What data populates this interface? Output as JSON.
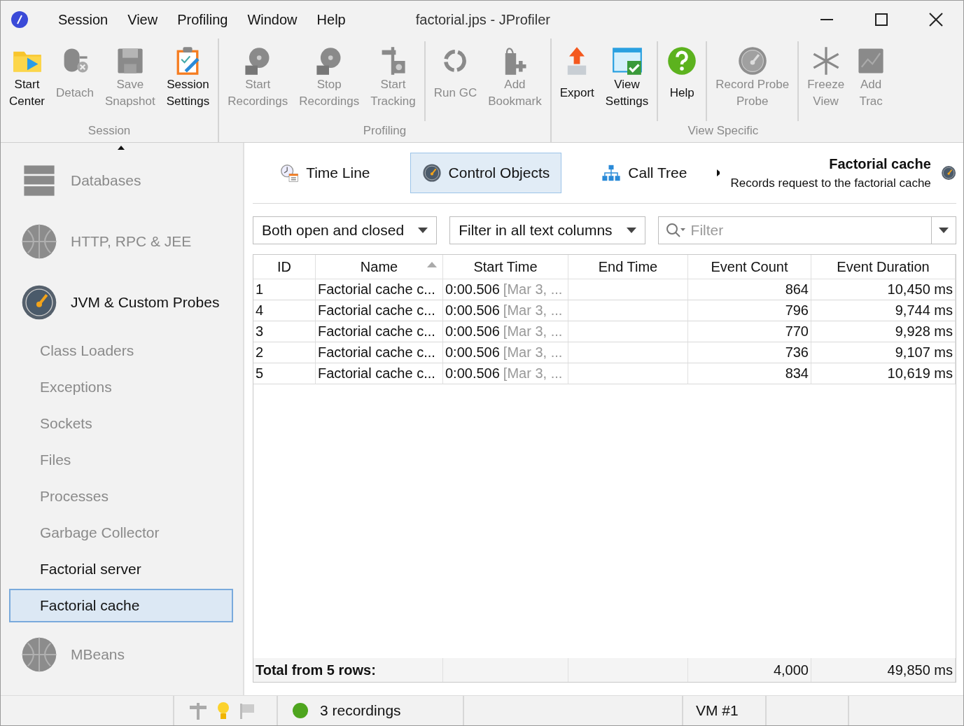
{
  "window": {
    "title": "factorial.jps - JProfiler",
    "menu": [
      "Session",
      "View",
      "Profiling",
      "Window",
      "Help"
    ]
  },
  "toolbar": [
    {
      "label": "Session",
      "sections": [
        [
          {
            "lines": [
              "Start",
              "Center"
            ],
            "disabled": false
          },
          {
            "lines": [
              "Detach"
            ],
            "disabled": true
          },
          {
            "lines": [
              "Save",
              "Snapshot"
            ],
            "disabled": true
          },
          {
            "lines": [
              "Session",
              "Settings"
            ],
            "disabled": false
          }
        ]
      ]
    },
    {
      "label": "Profiling",
      "sections": [
        [
          {
            "lines": [
              "Start",
              "Recordings"
            ],
            "disabled": true
          },
          {
            "lines": [
              "Stop",
              "Recordings"
            ],
            "disabled": true
          },
          {
            "lines": [
              "Start",
              "Tracking"
            ],
            "disabled": true
          }
        ],
        [
          {
            "lines": [
              "Run GC"
            ],
            "disabled": true
          },
          {
            "lines": [
              "Add",
              "Bookmark"
            ],
            "disabled": true
          }
        ]
      ]
    },
    {
      "label": "View Specific",
      "sections": [
        [
          {
            "lines": [
              "Export"
            ],
            "disabled": false
          },
          {
            "lines": [
              "View",
              "Settings"
            ],
            "disabled": false
          }
        ],
        [
          {
            "lines": [
              "Help"
            ],
            "disabled": false
          }
        ],
        [
          {
            "lines": [
              "Record Probe",
              "Probe"
            ],
            "disabled": true
          }
        ],
        [
          {
            "lines": [
              "Freeze",
              "View"
            ],
            "disabled": true
          },
          {
            "lines": [
              "Add",
              "Trac"
            ],
            "disabled": true
          }
        ]
      ]
    }
  ],
  "sidebar": [
    {
      "kind": "category",
      "label": "Databases",
      "disabled": true
    },
    {
      "kind": "category",
      "label": "HTTP, RPC & JEE",
      "disabled": true
    },
    {
      "kind": "category",
      "label": "JVM & Custom Probes",
      "disabled": false,
      "children": [
        {
          "kind": "item",
          "label": "Class Loaders",
          "disabled": true,
          "selected": false
        },
        {
          "kind": "item",
          "label": "Exceptions",
          "disabled": true,
          "selected": false
        },
        {
          "kind": "item",
          "label": "Sockets",
          "disabled": true,
          "selected": false
        },
        {
          "kind": "item",
          "label": "Files",
          "disabled": true,
          "selected": false
        },
        {
          "kind": "item",
          "label": "Processes",
          "disabled": true,
          "selected": false
        },
        {
          "kind": "item",
          "label": "Garbage Collector",
          "disabled": true,
          "selected": false
        },
        {
          "kind": "item",
          "label": "Factorial server",
          "disabled": false,
          "selected": false
        },
        {
          "kind": "item",
          "label": "Factorial cache",
          "disabled": false,
          "selected": true
        }
      ]
    },
    {
      "kind": "category",
      "label": "MBeans",
      "disabled": true
    }
  ],
  "view_tabs": [
    {
      "label": "Time Line",
      "selected": false
    },
    {
      "label": "Control Objects",
      "selected": true
    },
    {
      "label": "Call Tree",
      "selected": false
    }
  ],
  "probe": {
    "title": "Factorial cache",
    "description": "Records request to the factorial cache"
  },
  "filters": {
    "state": "Both open and closed",
    "columns": "Filter in all text columns",
    "search": {
      "placeholder": "Filter"
    }
  },
  "table": {
    "columns": [
      {
        "label": "ID",
        "sorted": false
      },
      {
        "label": "Name",
        "sorted": true
      },
      {
        "label": "Start Time",
        "sorted": false
      },
      {
        "label": "End Time",
        "sorted": false
      },
      {
        "label": "Event Count",
        "sorted": false
      },
      {
        "label": "Event Duration",
        "sorted": false
      }
    ],
    "rows": [
      {
        "id": "1",
        "name": "Factorial cache c...",
        "start": "0:00.506",
        "start_date": "[Mar 3, ...",
        "count": "864",
        "duration": "10,450 ms"
      },
      {
        "id": "4",
        "name": "Factorial cache c...",
        "start": "0:00.506",
        "start_date": "[Mar 3, ...",
        "count": "796",
        "duration": "9,744 ms"
      },
      {
        "id": "3",
        "name": "Factorial cache c...",
        "start": "0:00.506",
        "start_date": "[Mar 3, ...",
        "count": "770",
        "duration": "9,928 ms"
      },
      {
        "id": "2",
        "name": "Factorial cache c...",
        "start": "0:00.506",
        "start_date": "[Mar 3, ...",
        "count": "736",
        "duration": "9,107 ms"
      },
      {
        "id": "5",
        "name": "Factorial cache c...",
        "start": "0:00.506",
        "start_date": "[Mar 3, ...",
        "count": "834",
        "duration": "10,619 ms"
      }
    ],
    "total": {
      "label": "Total from 5 rows:",
      "count": "4,000",
      "duration": "49,850 ms"
    }
  },
  "status_bar": {
    "recordings": "3 recordings",
    "vm": "VM #1"
  }
}
